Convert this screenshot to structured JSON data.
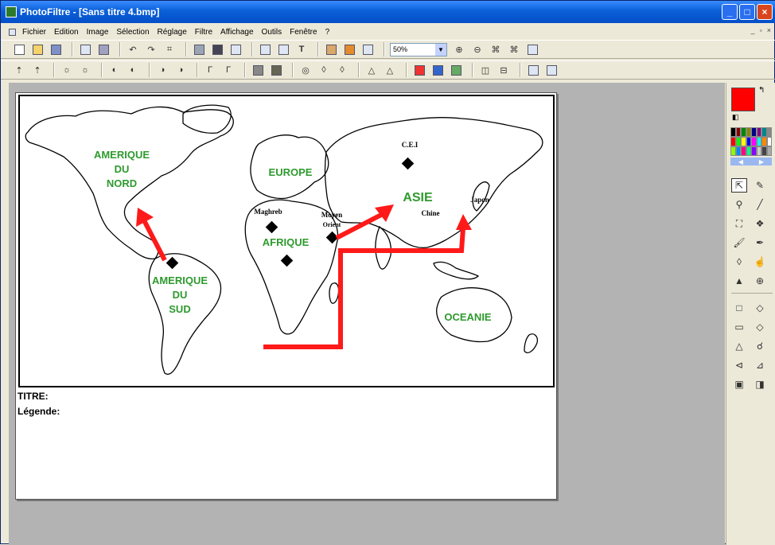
{
  "window": {
    "title": "PhotoFiltre - [Sans titre 4.bmp]"
  },
  "menu": [
    "Fichier",
    "Edition",
    "Image",
    "Sélection",
    "Réglage",
    "Filtre",
    "Affichage",
    "Outils",
    "Fenêtre",
    "?"
  ],
  "toolbar": {
    "zoom": "50%"
  },
  "map": {
    "labels": {
      "amerique_nord": [
        "AMERIQUE",
        "DU",
        "NORD"
      ],
      "amerique_sud": [
        "AMERIQUE",
        "DU",
        "SUD"
      ],
      "europe": "EUROPE",
      "afrique": "AFRIQUE",
      "asie": "ASIE",
      "oceanie": "OCEANIE",
      "cei": "C.E.I",
      "maghreb": "Maghreb",
      "moyen_orient": [
        "Moyen",
        "Orient"
      ],
      "chine": "Chine",
      "japon": "Japon"
    },
    "label_color": "#2e9a2e",
    "arrow_color": "#ff1a1a"
  },
  "captions": {
    "titre": "TITRE:",
    "legende": "Légende:"
  },
  "palette": {
    "foreground": "#ff0000",
    "background": "#ffffff"
  }
}
